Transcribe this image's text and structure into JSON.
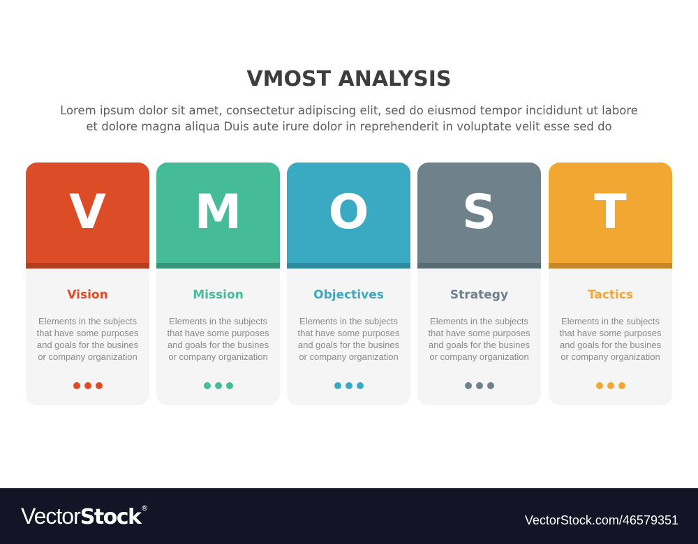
{
  "header": {
    "title": "VMOST ANALYSIS",
    "subtitle_lines": [
      "Lorem ipsum dolor sit amet, consectetur adipiscing elit, sed do eiusmod tempor incididunt ut labore",
      "et dolore magna aliqua Duis aute irure dolor in reprehenderit in voluptate velit esse sed do"
    ]
  },
  "cards": [
    {
      "letter": "V",
      "title": "Vision",
      "color": "#dc4c26",
      "stripe": "#b33f20",
      "desc_lines": [
        "Elements in the subjects",
        "that have some purposes",
        "and goals for the  busines",
        "or company organization"
      ]
    },
    {
      "letter": "M",
      "title": "Mission",
      "color": "#46bb98",
      "stripe": "#38957a",
      "desc_lines": [
        "Elements in the subjects",
        "that have some purposes",
        "and goals for the  busines",
        "or company organization"
      ]
    },
    {
      "letter": "O",
      "title": "Objectives",
      "color": "#3aaac2",
      "stripe": "#2e8a9c",
      "desc_lines": [
        "Elements in the subjects",
        "that have some purposes",
        "and goals for the  busines",
        "or company organization"
      ]
    },
    {
      "letter": "S",
      "title": "Strategy",
      "color": "#6f818b",
      "stripe": "#5a6a72",
      "desc_lines": [
        "Elements in the subjects",
        "that have some purposes",
        "and goals for the  busines",
        "or company organization"
      ]
    },
    {
      "letter": "T",
      "title": "Tactics",
      "color": "#f2a732",
      "stripe": "#c8862a",
      "desc_lines": [
        "Elements in the subjects",
        "that have some purposes",
        "and goals for the  busines",
        "or company organization"
      ]
    }
  ],
  "footer": {
    "brand_light": "Vector",
    "brand_bold": "Stock",
    "brand_mark": "®",
    "image_id_text": "VectorStock.com/46579351"
  }
}
